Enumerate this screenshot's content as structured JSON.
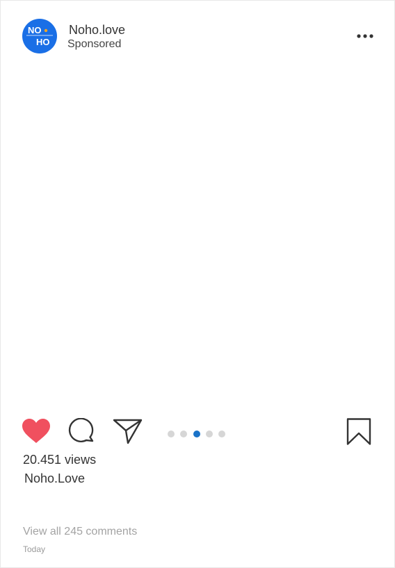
{
  "post": {
    "account": {
      "name": "Noho.love",
      "label": "Sponsored",
      "avatar_lines": [
        "NO",
        "HO"
      ],
      "avatar_color": "#1a6fe6"
    },
    "menu_icon": "more-horizontal-icon",
    "actions": {
      "like_icon": "heart-filled-icon",
      "like_color": "#f0505f",
      "comment_icon": "comment-bubble-icon",
      "share_icon": "paper-plane-icon",
      "save_icon": "bookmark-icon"
    },
    "carousel": {
      "total": 5,
      "active_index": 3,
      "active_color": "#1a73c8",
      "inactive_color": "#d6d6d6"
    },
    "views": "20.451 views",
    "caption": "Noho.Love",
    "comments_link": "View all 245 comments",
    "timestamp": "Today"
  }
}
